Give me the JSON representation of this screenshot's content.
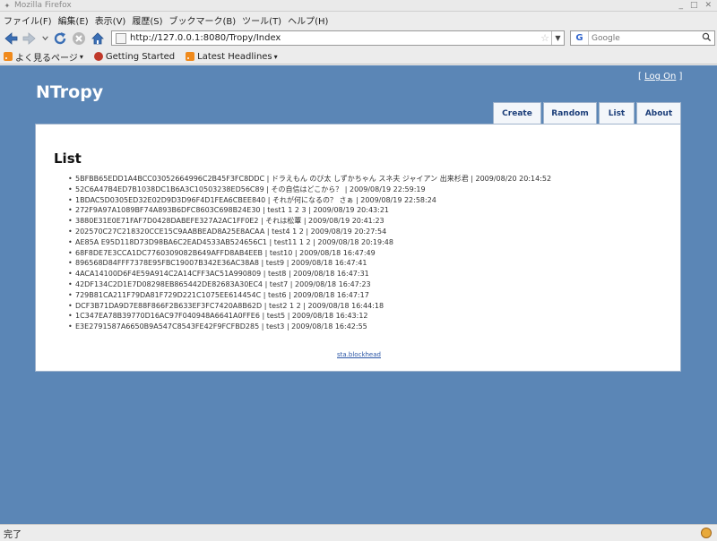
{
  "window": {
    "title": "Mozilla Firefox"
  },
  "menu": [
    "ファイル(F)",
    "編集(E)",
    "表示(V)",
    "履歴(S)",
    "ブックマーク(B)",
    "ツール(T)",
    "ヘルプ(H)"
  ],
  "address": {
    "url": "http://127.0.0.1:8080/Tropy/Index"
  },
  "search": {
    "engine": "G",
    "placeholder": "Google"
  },
  "bookmarks": [
    "よく見るページ",
    "Getting Started",
    "Latest Headlines"
  ],
  "site": {
    "brand": "NTropy",
    "login": {
      "open": "[",
      "link": "Log On",
      "close": "]"
    },
    "tabs": [
      "Create",
      "Random",
      "List",
      "About"
    ],
    "heading": "List",
    "items": [
      "5BFBB65EDD1A4BCC03052664996C2B45F3FC8DDC | ドラえもん のび太 しずかちゃん スネ夫 ジャイアン 出来杉君 | 2009/08/20 20:14:52",
      "52C6A47B4ED7B1038DC1B6A3C10503238ED56C89 | その自信はどこから？ | 2009/08/19 22:59:19",
      "1BDAC5D0305ED32E02D9D3D96F4D1FEA6CBEE840 | それが何になるの？ さぁ | 2009/08/19 22:58:24",
      "272F9A97A1089BF74A893B6DFC8603C698B24E30 | test1 1 2 3 | 2009/08/19 20:43:21",
      "3880E31E0E71FAF7D0428DABEFE327A2AC1FF0E2 | それは松蕈 | 2009/08/19 20:41:23",
      "202570C27C218320CCE15C9AABBEAD8A25E8ACAA | test4 1 2 | 2009/08/19 20:27:54",
      "AE85A E95D118D73D98BA6C2EAD4533AB524656C1 | test11 1 2 | 2009/08/18 20:19:48",
      "68F8DE7E3CCA1DC7760309082B649AFFD8AB4EEB | test10 | 2009/08/18 16:47:49",
      "896568D84FFF7378E95FBC19007B342E36AC38A8 | test9 | 2009/08/18 16:47:41",
      "4ACA14100D6F4E59A914C2A14CFF3AC51A990809 | test8 | 2009/08/18 16:47:31",
      "42DF134C2D1E7D08298EB865442DE82683A30EC4 | test7 | 2009/08/18 16:47:23",
      "729B81CA211F79DA81F729D221C1075EE614454C | test6 | 2009/08/18 16:47:17",
      "DCF3B71DA9D7E88F866F2B633EF3FC7420A8B62D | test2 1 2 | 2009/08/18 16:44:18",
      "1C347EA78B39770D16AC97F040948A6641A0FFE6 | test5 | 2009/08/18 16:43:12",
      "E3E2791587A6650B9A547C8543FE42F9FCFBD285 | test3 | 2009/08/18 16:42:55"
    ],
    "footer": "sta.blockhead"
  },
  "status": {
    "text": "完了"
  }
}
